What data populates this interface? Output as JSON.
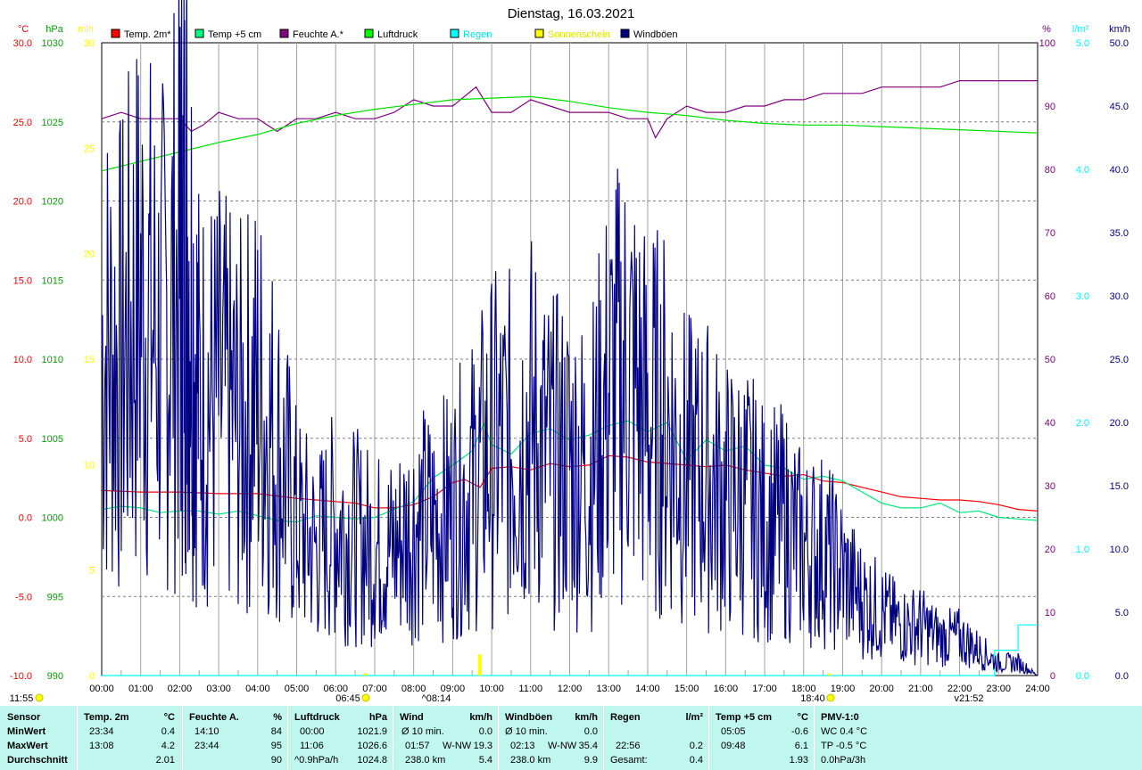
{
  "chart_data": {
    "type": "line",
    "title": "Dienstag, 16.03.2021",
    "x_ticks": [
      "00:00",
      "01:00",
      "02:00",
      "03:00",
      "04:00",
      "05:00",
      "06:00",
      "07:00",
      "08:00",
      "09:00",
      "10:00",
      "11:00",
      "12:00",
      "13:00",
      "14:00",
      "15:00",
      "16:00",
      "17:00",
      "18:00",
      "19:00",
      "20:00",
      "21:00",
      "22:00",
      "23:00",
      "24:00"
    ],
    "axes": {
      "temp": {
        "unit": "°C",
        "range": [
          -10,
          30
        ],
        "ticks": [
          "30.0",
          "25.0",
          "20.0",
          "15.0",
          "10.0",
          "5.0",
          "0.0",
          "-5.0",
          "-10.0"
        ],
        "color": "#ff0000"
      },
      "pressure": {
        "unit": "hPa",
        "range": [
          990,
          1030
        ],
        "ticks": [
          "1030",
          "1025",
          "1020",
          "1015",
          "1010",
          "1005",
          "1000",
          "995",
          "990"
        ],
        "color": "#00a000"
      },
      "sunshine": {
        "unit": "min",
        "range": [
          0,
          30
        ],
        "ticks": [
          "30",
          "25",
          "20",
          "15",
          "10",
          "5",
          "0"
        ],
        "color": "#ffff00"
      },
      "humidity": {
        "unit": "%",
        "range": [
          0,
          100
        ],
        "ticks": [
          "100",
          "90",
          "80",
          "70",
          "60",
          "50",
          "40",
          "30",
          "20",
          "10",
          "0"
        ],
        "color": "#800080"
      },
      "rain": {
        "unit": "l/m²",
        "range": [
          0,
          5
        ],
        "ticks": [
          "5.0",
          "4.0",
          "3.0",
          "2.0",
          "1.0",
          "0.0"
        ],
        "color": "#00ffff"
      },
      "wind": {
        "unit": "km/h",
        "range": [
          0,
          50
        ],
        "ticks": [
          "50.0",
          "45.0",
          "40.0",
          "35.0",
          "30.0",
          "25.0",
          "20.0",
          "15.0",
          "10.0",
          "5.0",
          "0.0"
        ],
        "color": "#000080"
      }
    },
    "legend": [
      {
        "label": "Temp. 2m*",
        "color": "#ff0000"
      },
      {
        "label": "Temp +5 cm",
        "color": "#00ff80"
      },
      {
        "label": "Feuchte A.*",
        "color": "#800080"
      },
      {
        "label": "Luftdruck",
        "color": "#00ff00"
      },
      {
        "label": "Regen",
        "color": "#00ffff"
      },
      {
        "label": "Sonnenschein",
        "color": "#ffff00"
      },
      {
        "label": "Windböen",
        "color": "#000080"
      }
    ],
    "series": [
      {
        "name": "Temp. 2m*",
        "axis": "temp",
        "color": "#ff0000",
        "x": [
          0,
          1,
          2,
          3,
          4,
          5,
          5.5,
          6,
          6.5,
          7,
          7.5,
          8,
          8.5,
          9,
          9.3,
          9.7,
          10,
          10.5,
          11,
          11.5,
          12,
          12.5,
          13,
          13.5,
          14,
          14.5,
          15,
          15.5,
          16,
          16.5,
          17,
          17.5,
          18,
          18.5,
          19,
          19.5,
          20,
          20.5,
          21,
          21.5,
          22,
          22.5,
          23,
          23.5,
          24
        ],
        "y": [
          1.7,
          1.6,
          1.6,
          1.5,
          1.5,
          1.2,
          1.1,
          1.0,
          0.9,
          0.6,
          0.6,
          0.8,
          1.3,
          2.2,
          2.4,
          1.9,
          3.1,
          3.2,
          3.0,
          3.4,
          3.2,
          3.3,
          3.9,
          3.8,
          3.5,
          3.4,
          3.3,
          3.2,
          3.3,
          3.0,
          2.8,
          2.6,
          2.7,
          2.3,
          2.2,
          1.9,
          1.6,
          1.3,
          1.2,
          1.1,
          1.1,
          1.0,
          0.8,
          0.5,
          0.4
        ]
      },
      {
        "name": "Temp +5 cm",
        "axis": "temp",
        "color": "#00e87a",
        "x": [
          0,
          0.5,
          1,
          1.5,
          2,
          2.5,
          3,
          3.5,
          4,
          4.5,
          5,
          5.5,
          6,
          6.5,
          7,
          7.5,
          8,
          8.5,
          9,
          9.5,
          9.8,
          10,
          10.5,
          11,
          11.5,
          12,
          12.5,
          13,
          13.5,
          14,
          14.5,
          15,
          15.5,
          16,
          16.5,
          17,
          17.5,
          18,
          18.5,
          19,
          19.5,
          20,
          20.5,
          21,
          21.5,
          22,
          22.5,
          23,
          23.5,
          24
        ],
        "y": [
          0.5,
          0.7,
          0.6,
          0.3,
          0.4,
          0.4,
          0.2,
          0.4,
          0.1,
          -0.2,
          -0.3,
          0.1,
          0.0,
          -0.1,
          0.0,
          0.5,
          1.0,
          2.5,
          3.3,
          4.2,
          5.9,
          4.6,
          4.0,
          5.3,
          5.6,
          4.9,
          5.2,
          5.8,
          6.1,
          5.4,
          6.0,
          3.6,
          4.9,
          4.2,
          4.5,
          3.3,
          3.1,
          2.4,
          2.6,
          2.3,
          1.6,
          0.9,
          0.6,
          0.6,
          0.9,
          0.3,
          0.4,
          0.0,
          -0.1,
          -0.2
        ]
      },
      {
        "name": "Feuchte A.*",
        "axis": "humidity",
        "color": "#800080",
        "x": [
          0,
          0.5,
          1,
          1.5,
          2,
          2.3,
          2.6,
          3,
          3.5,
          4,
          4.5,
          5,
          5.5,
          6,
          6.5,
          7,
          7.5,
          8,
          8.5,
          9,
          9.6,
          10,
          10.5,
          11,
          11.5,
          12,
          12.5,
          13,
          13.5,
          14,
          14.2,
          14.5,
          15,
          15.5,
          16,
          16.5,
          17,
          17.5,
          18,
          18.5,
          19,
          19.5,
          20,
          20.5,
          21,
          21.5,
          22,
          22.5,
          23,
          23.5,
          24
        ],
        "y": [
          88,
          89,
          88,
          88,
          88,
          86,
          87,
          89,
          88,
          88,
          86,
          88,
          88,
          89,
          88,
          88,
          89,
          91,
          90,
          90,
          93,
          89,
          89,
          91,
          90,
          89,
          89,
          89,
          88,
          88,
          85,
          88,
          90,
          89,
          89,
          90,
          90,
          91,
          91,
          92,
          92,
          92,
          93,
          93,
          93,
          93,
          94,
          94,
          94,
          94,
          94
        ]
      },
      {
        "name": "Luftdruck",
        "axis": "pressure",
        "color": "#00e000",
        "x": [
          0,
          1,
          2,
          3,
          4,
          5,
          6,
          7,
          8,
          9,
          10,
          11,
          12,
          13,
          14,
          15,
          16,
          17,
          18,
          19,
          20,
          21,
          22,
          23,
          24
        ],
        "y": [
          1021.9,
          1022.5,
          1023.1,
          1023.7,
          1024.2,
          1024.9,
          1025.4,
          1025.8,
          1026.1,
          1026.4,
          1026.5,
          1026.6,
          1026.3,
          1025.9,
          1025.6,
          1025.4,
          1025.1,
          1024.9,
          1024.8,
          1024.8,
          1024.7,
          1024.6,
          1024.5,
          1024.4,
          1024.3
        ]
      },
      {
        "name": "Regen",
        "axis": "rain",
        "color": "#00ffff",
        "x": [
          0,
          22.9,
          22.9,
          23.5,
          23.5,
          24
        ],
        "y": [
          0,
          0,
          0.2,
          0.2,
          0.4,
          0.4
        ]
      },
      {
        "name": "Windböen",
        "axis": "wind",
        "color": "#000080",
        "generated": true,
        "x": [
          0,
          0.5,
          1,
          1.5,
          2,
          2.2,
          2.5,
          3,
          3.5,
          4,
          4.5,
          5,
          5.5,
          6,
          6.5,
          7,
          7.5,
          8,
          8.5,
          9,
          9.5,
          10,
          10.5,
          11,
          11.5,
          12,
          12.5,
          13,
          13.5,
          14,
          14.5,
          15,
          15.5,
          16,
          16.5,
          17,
          17.5,
          18,
          18.5,
          19,
          19.5,
          20,
          20.5,
          21,
          21.5,
          22,
          22.5,
          23,
          23.5,
          24
        ],
        "y": [
          26,
          25,
          30,
          26,
          32,
          35,
          22,
          22,
          20,
          22,
          18,
          12,
          10,
          12,
          11,
          10,
          10,
          12,
          12,
          13,
          15,
          18,
          18,
          20,
          17,
          17,
          16,
          22,
          24,
          20,
          20,
          16,
          16,
          14,
          14,
          12,
          12,
          10,
          10,
          8,
          6,
          5,
          4,
          4,
          3,
          3,
          2,
          1,
          1,
          0
        ]
      },
      {
        "name": "Sonnenschein",
        "axis": "sunshine",
        "color": "#ffff00",
        "x": [
          6.75,
          9.7,
          18.65
        ],
        "y": [
          0.1,
          1.0,
          0.1
        ]
      }
    ],
    "markers": {
      "sunrise_label": "06:45",
      "sunset_label": "18:40",
      "moon_label_left": "11:55",
      "moon_rise_label": "^08:14",
      "moon_set_label": "v21:52"
    }
  },
  "stats": {
    "header": {
      "sensor": "Sensor",
      "temp": "Temp. 2m",
      "temp_unit": "°C",
      "hum": "Feuchte A.",
      "hum_unit": "%",
      "press": "Luftdruck",
      "press_unit": "hPa",
      "wind": "Wind",
      "wind_unit": "km/h",
      "gust": "Windböen",
      "gust_unit": "km/h",
      "rain": "Regen",
      "rain_unit": "l/m²",
      "t5": "Temp +5 cm",
      "t5_unit": "°C",
      "pmv": "PMV-1:0"
    },
    "rowlabels": {
      "min": "MinWert",
      "max": "MaxWert",
      "avg": "Durchschnitt"
    },
    "temp": {
      "min_time": "23:34",
      "min_val": "0.4",
      "max_time": "13:08",
      "max_val": "4.2",
      "avg": "2.01"
    },
    "hum": {
      "min_time": "14:10",
      "min_val": "84",
      "max_time": "23:44",
      "max_val": "95",
      "avg": "90"
    },
    "press": {
      "min_time": "00:00",
      "min_val": "1021.9",
      "max_time": "11:06",
      "max_val": "1026.6",
      "avg_label": "^0.9hPa/h",
      "avg": "1024.8"
    },
    "wind": {
      "min_label": "Ø 10 min.",
      "min_val": "0.0",
      "max_time": "01:57",
      "max_dir": "W-NW",
      "max_val": "19.3",
      "avg_label": "238.0 km",
      "avg": "5.4"
    },
    "gust": {
      "min_label": "Ø 10 min.",
      "min_val": "0.0",
      "max_time": "02:13",
      "max_dir": "W-NW",
      "max_val": "35.4",
      "avg_label": "238.0 km",
      "avg": "9.9"
    },
    "rain": {
      "max_time": "22:56",
      "max_val": "0.2",
      "avg_label": "Gesamt:",
      "avg": "0.4"
    },
    "t5": {
      "min_time": "05:05",
      "min_val": "-0.6",
      "max_time": "09:48",
      "max_val": "6.1",
      "avg": "1.93"
    },
    "pmv": {
      "min": "WC 0.4 °C",
      "max": "TP -0.5 °C",
      "avg": "0.0hPa/3h"
    }
  }
}
